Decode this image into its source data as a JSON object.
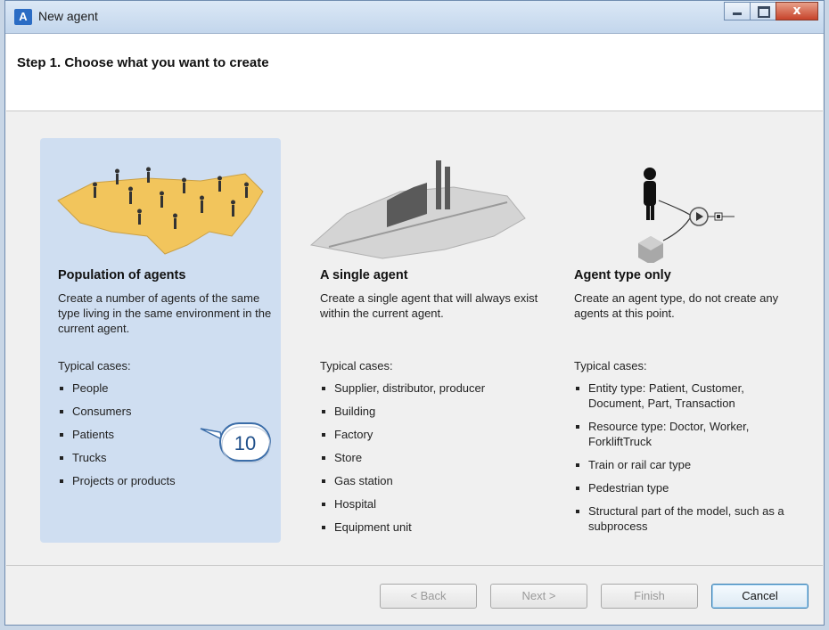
{
  "window": {
    "title": "New agent",
    "close_label": "x"
  },
  "header": {
    "step_title": "Step 1. Choose what you want to create"
  },
  "panels": [
    {
      "title": "Population of agents",
      "description": "Create a number of agents of the same type living in the same environment in the current agent.",
      "typical_label": "Typical cases:",
      "cases": [
        "People",
        "Consumers",
        "Patients",
        "Trucks",
        "Projects or products"
      ],
      "selected": true
    },
    {
      "title": "A single agent",
      "description": "Create a single agent that will always exist within the current agent.",
      "typical_label": "Typical cases:",
      "cases": [
        "Supplier, distributor, producer",
        "Building",
        "Factory",
        "Store",
        "Gas station",
        "Hospital",
        "Equipment unit"
      ],
      "selected": false
    },
    {
      "title": "Agent type only",
      "description": "Create an agent type, do not create any agents at this point.",
      "typical_label": "Typical cases:",
      "cases": [
        "Entity type: Patient, Customer, Document, Part, Transaction",
        "Resource type: Doctor, Worker, ForkliftTruck",
        "Train or rail car type",
        "Pedestrian type",
        "Structural part of the model, such as a subprocess"
      ],
      "selected": false
    }
  ],
  "callout": {
    "number": "10"
  },
  "buttons": {
    "back": "< Back",
    "next": "Next >",
    "finish": "Finish",
    "cancel": "Cancel"
  },
  "colors": {
    "selected_panel": "#cfdef1",
    "title_bar": "#c3d6ec",
    "close_button": "#c7432b",
    "map_fill": "#f2c55c"
  }
}
